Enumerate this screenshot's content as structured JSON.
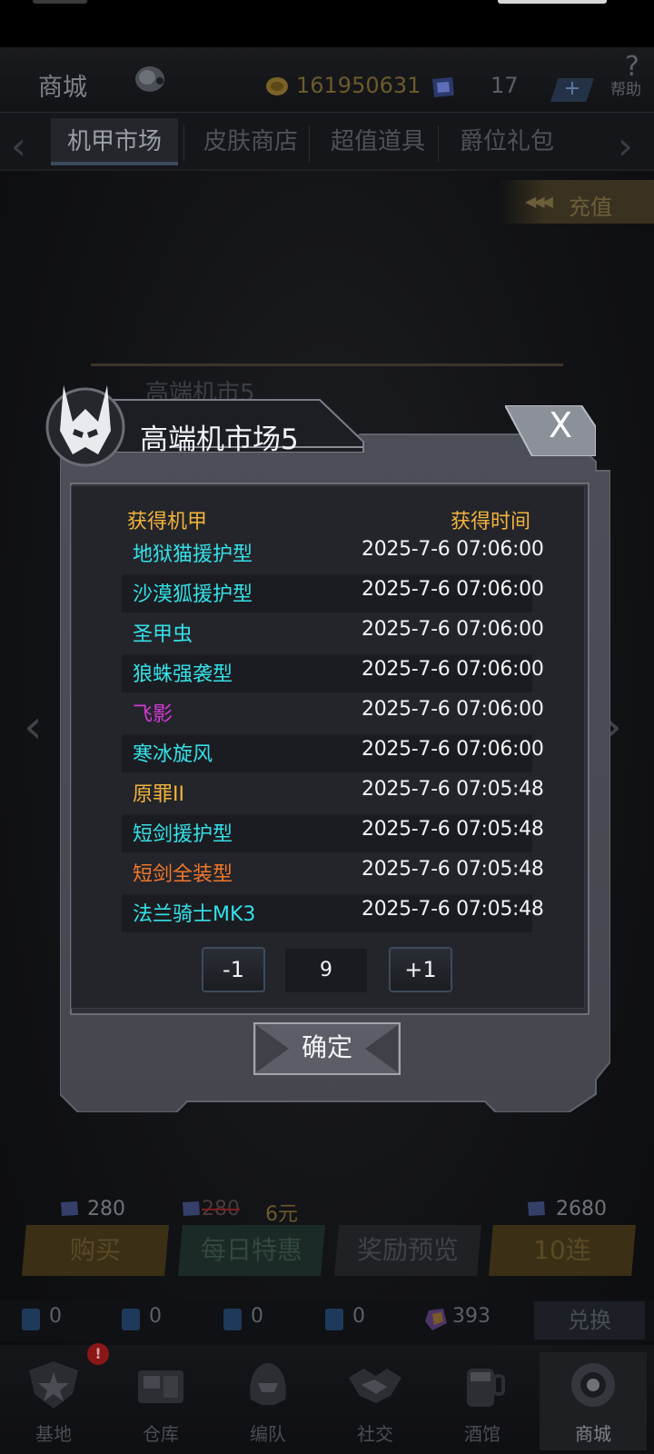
{
  "header": {
    "title": "商城",
    "coins": "161950631",
    "gems": "17",
    "plus_label": "+",
    "help_icon": "?",
    "help_label": "帮助"
  },
  "tabs": [
    {
      "label": "机甲市场",
      "active": true
    },
    {
      "label": "皮肤商店",
      "active": false
    },
    {
      "label": "超值道具",
      "active": false
    },
    {
      "label": "爵位礼包",
      "active": false
    }
  ],
  "recharge": {
    "label": "充值"
  },
  "background": {
    "market_title": "高端机市5"
  },
  "dialog": {
    "title": "高端机市场5",
    "close_label": "X",
    "col_mech": "获得机甲",
    "col_time": "获得时间",
    "rows": [
      {
        "name": "地狱猫援护型",
        "time": "2025-7-6 07:06:00",
        "color": "#35e1e8"
      },
      {
        "name": "沙漠狐援护型",
        "time": "2025-7-6 07:06:00",
        "color": "#35e1e8"
      },
      {
        "name": "圣甲虫",
        "time": "2025-7-6 07:06:00",
        "color": "#35e1e8"
      },
      {
        "name": "狼蛛强袭型",
        "time": "2025-7-6 07:06:00",
        "color": "#35e1e8"
      },
      {
        "name": "飞影",
        "time": "2025-7-6 07:06:00",
        "color": "#d23ad4"
      },
      {
        "name": "寒冰旋风",
        "time": "2025-7-6 07:06:00",
        "color": "#35e1e8"
      },
      {
        "name": "原罪II",
        "time": "2025-7-6 07:05:48",
        "color": "#f1b43b"
      },
      {
        "name": "短剑援护型",
        "time": "2025-7-6 07:05:48",
        "color": "#35e1e8"
      },
      {
        "name": "短剑全装型",
        "time": "2025-7-6 07:05:48",
        "color": "#f0772a"
      },
      {
        "name": "法兰骑士MK3",
        "time": "2025-7-6 07:05:48",
        "color": "#35e1e8"
      }
    ],
    "stepper": {
      "minus": "-1",
      "value": "9",
      "plus": "+1"
    },
    "confirm_label": "确定"
  },
  "prices": {
    "single": "280",
    "daily_old": "280",
    "daily_new": "6元",
    "ten": "2680"
  },
  "actions": {
    "buy": "购买",
    "daily": "每日特惠",
    "preview": "奖励预览",
    "ten": "10连"
  },
  "resources": {
    "r1": "0",
    "r2": "0",
    "r3": "0",
    "r4": "0",
    "crystal": "393",
    "exchange_label": "兑换"
  },
  "nav": [
    {
      "label": "基地",
      "icon": "star-badge-icon",
      "badge": "!"
    },
    {
      "label": "仓库",
      "icon": "warehouse-icon"
    },
    {
      "label": "编队",
      "icon": "helmet-icon"
    },
    {
      "label": "社交",
      "icon": "handshake-icon"
    },
    {
      "label": "酒馆",
      "icon": "tavern-icon"
    },
    {
      "label": "商城",
      "icon": "shop-orb-icon",
      "active": true
    }
  ],
  "colors": {
    "accent_gold": "#f1b43b",
    "cyan": "#35e1e8",
    "purple": "#d23ad4",
    "orange": "#f0772a"
  }
}
